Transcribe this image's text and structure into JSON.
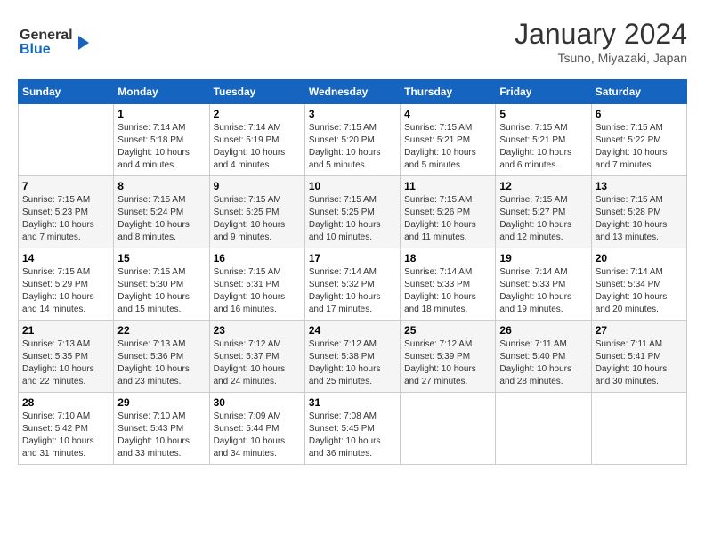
{
  "header": {
    "logo_general": "General",
    "logo_blue": "Blue",
    "month_year": "January 2024",
    "location": "Tsuno, Miyazaki, Japan"
  },
  "calendar": {
    "days_of_week": [
      "Sunday",
      "Monday",
      "Tuesday",
      "Wednesday",
      "Thursday",
      "Friday",
      "Saturday"
    ],
    "weeks": [
      [
        {
          "day": "",
          "info": ""
        },
        {
          "day": "1",
          "info": "Sunrise: 7:14 AM\nSunset: 5:18 PM\nDaylight: 10 hours\nand 4 minutes."
        },
        {
          "day": "2",
          "info": "Sunrise: 7:14 AM\nSunset: 5:19 PM\nDaylight: 10 hours\nand 4 minutes."
        },
        {
          "day": "3",
          "info": "Sunrise: 7:15 AM\nSunset: 5:20 PM\nDaylight: 10 hours\nand 5 minutes."
        },
        {
          "day": "4",
          "info": "Sunrise: 7:15 AM\nSunset: 5:21 PM\nDaylight: 10 hours\nand 5 minutes."
        },
        {
          "day": "5",
          "info": "Sunrise: 7:15 AM\nSunset: 5:21 PM\nDaylight: 10 hours\nand 6 minutes."
        },
        {
          "day": "6",
          "info": "Sunrise: 7:15 AM\nSunset: 5:22 PM\nDaylight: 10 hours\nand 7 minutes."
        }
      ],
      [
        {
          "day": "7",
          "info": "Sunrise: 7:15 AM\nSunset: 5:23 PM\nDaylight: 10 hours\nand 7 minutes."
        },
        {
          "day": "8",
          "info": "Sunrise: 7:15 AM\nSunset: 5:24 PM\nDaylight: 10 hours\nand 8 minutes."
        },
        {
          "day": "9",
          "info": "Sunrise: 7:15 AM\nSunset: 5:25 PM\nDaylight: 10 hours\nand 9 minutes."
        },
        {
          "day": "10",
          "info": "Sunrise: 7:15 AM\nSunset: 5:25 PM\nDaylight: 10 hours\nand 10 minutes."
        },
        {
          "day": "11",
          "info": "Sunrise: 7:15 AM\nSunset: 5:26 PM\nDaylight: 10 hours\nand 11 minutes."
        },
        {
          "day": "12",
          "info": "Sunrise: 7:15 AM\nSunset: 5:27 PM\nDaylight: 10 hours\nand 12 minutes."
        },
        {
          "day": "13",
          "info": "Sunrise: 7:15 AM\nSunset: 5:28 PM\nDaylight: 10 hours\nand 13 minutes."
        }
      ],
      [
        {
          "day": "14",
          "info": "Sunrise: 7:15 AM\nSunset: 5:29 PM\nDaylight: 10 hours\nand 14 minutes."
        },
        {
          "day": "15",
          "info": "Sunrise: 7:15 AM\nSunset: 5:30 PM\nDaylight: 10 hours\nand 15 minutes."
        },
        {
          "day": "16",
          "info": "Sunrise: 7:15 AM\nSunset: 5:31 PM\nDaylight: 10 hours\nand 16 minutes."
        },
        {
          "day": "17",
          "info": "Sunrise: 7:14 AM\nSunset: 5:32 PM\nDaylight: 10 hours\nand 17 minutes."
        },
        {
          "day": "18",
          "info": "Sunrise: 7:14 AM\nSunset: 5:33 PM\nDaylight: 10 hours\nand 18 minutes."
        },
        {
          "day": "19",
          "info": "Sunrise: 7:14 AM\nSunset: 5:33 PM\nDaylight: 10 hours\nand 19 minutes."
        },
        {
          "day": "20",
          "info": "Sunrise: 7:14 AM\nSunset: 5:34 PM\nDaylight: 10 hours\nand 20 minutes."
        }
      ],
      [
        {
          "day": "21",
          "info": "Sunrise: 7:13 AM\nSunset: 5:35 PM\nDaylight: 10 hours\nand 22 minutes."
        },
        {
          "day": "22",
          "info": "Sunrise: 7:13 AM\nSunset: 5:36 PM\nDaylight: 10 hours\nand 23 minutes."
        },
        {
          "day": "23",
          "info": "Sunrise: 7:12 AM\nSunset: 5:37 PM\nDaylight: 10 hours\nand 24 minutes."
        },
        {
          "day": "24",
          "info": "Sunrise: 7:12 AM\nSunset: 5:38 PM\nDaylight: 10 hours\nand 25 minutes."
        },
        {
          "day": "25",
          "info": "Sunrise: 7:12 AM\nSunset: 5:39 PM\nDaylight: 10 hours\nand 27 minutes."
        },
        {
          "day": "26",
          "info": "Sunrise: 7:11 AM\nSunset: 5:40 PM\nDaylight: 10 hours\nand 28 minutes."
        },
        {
          "day": "27",
          "info": "Sunrise: 7:11 AM\nSunset: 5:41 PM\nDaylight: 10 hours\nand 30 minutes."
        }
      ],
      [
        {
          "day": "28",
          "info": "Sunrise: 7:10 AM\nSunset: 5:42 PM\nDaylight: 10 hours\nand 31 minutes."
        },
        {
          "day": "29",
          "info": "Sunrise: 7:10 AM\nSunset: 5:43 PM\nDaylight: 10 hours\nand 33 minutes."
        },
        {
          "day": "30",
          "info": "Sunrise: 7:09 AM\nSunset: 5:44 PM\nDaylight: 10 hours\nand 34 minutes."
        },
        {
          "day": "31",
          "info": "Sunrise: 7:08 AM\nSunset: 5:45 PM\nDaylight: 10 hours\nand 36 minutes."
        },
        {
          "day": "",
          "info": ""
        },
        {
          "day": "",
          "info": ""
        },
        {
          "day": "",
          "info": ""
        }
      ]
    ]
  }
}
